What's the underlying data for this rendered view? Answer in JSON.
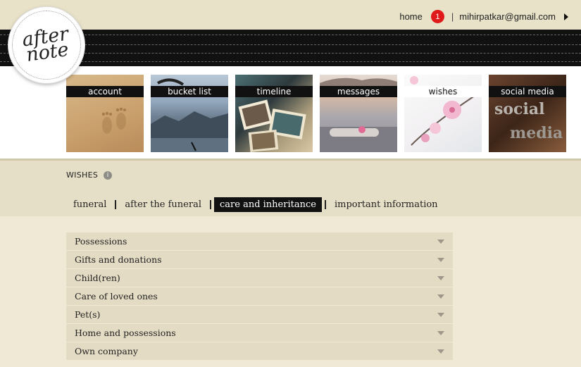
{
  "logo": {
    "line1": "after",
    "line2": "note"
  },
  "topnav": {
    "home": "home",
    "notification_count": "1",
    "separator": "|",
    "email": "mihirpatkar@gmail.com"
  },
  "tiles": [
    {
      "label": "account"
    },
    {
      "label": "bucket list"
    },
    {
      "label": "timeline"
    },
    {
      "label": "messages"
    },
    {
      "label": "wishes"
    },
    {
      "label": "social media"
    }
  ],
  "social_tile_text": [
    "social",
    "media"
  ],
  "section": {
    "title": "WISHES"
  },
  "subtabs": [
    {
      "label": "funeral"
    },
    {
      "label": "after the funeral"
    },
    {
      "label": "care and inheritance"
    },
    {
      "label": "important information"
    }
  ],
  "accordion": [
    {
      "label": "Possessions"
    },
    {
      "label": "Gifts and donations"
    },
    {
      "label": "Child(ren)"
    },
    {
      "label": "Care of loved ones"
    },
    {
      "label": "Pet(s)"
    },
    {
      "label": "Home and possessions"
    },
    {
      "label": "Own company"
    }
  ],
  "colors": {
    "page_bg": "#f0e9d6",
    "header_band": "#111111",
    "badge": "#e01a1a",
    "accordion_row": "#e3dbc3",
    "active_tab": "#111111"
  },
  "icons": {
    "notification": "notification-badge",
    "menu_caret": "caret-right-icon",
    "info": "info-icon",
    "accordion_toggle": "chevron-down-icon"
  }
}
